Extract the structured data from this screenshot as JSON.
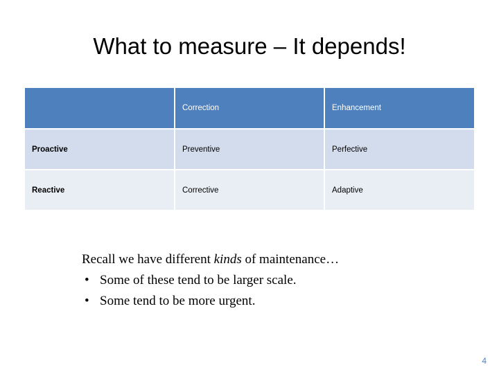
{
  "slide": {
    "title": "What to measure – It depends!",
    "page_number": "4",
    "accent_color": "#4e80bd",
    "band_a_color": "#d3dced",
    "band_b_color": "#e9edf4"
  },
  "table": {
    "headers": [
      "",
      "Correction",
      "Enhancement"
    ],
    "rows": [
      {
        "label": "Proactive",
        "cells": [
          "Preventive",
          "Perfective"
        ]
      },
      {
        "label": "Reactive",
        "cells": [
          "Corrective",
          "Adaptive"
        ]
      }
    ]
  },
  "body": {
    "lead_before": "Recall we have different ",
    "lead_italic": "kinds",
    "lead_after": " of maintenance…",
    "bullet_mark": "•",
    "bullets": [
      "Some of these tend to be larger scale.",
      "Some tend to be more urgent."
    ]
  }
}
